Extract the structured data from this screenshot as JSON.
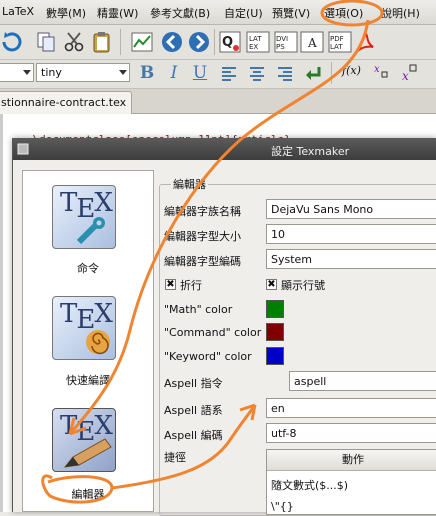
{
  "menubar": {
    "items": [
      "LaTeX",
      "數學(M)",
      "精靈(W)",
      "參考文獻(B)",
      "自定(U)",
      "預覽(V)",
      "選項(O)",
      "說明(H)"
    ]
  },
  "toolbar2": {
    "size_combo": "tiny"
  },
  "tabs": {
    "document": "stionnaire-contract.tex"
  },
  "editor": {
    "line1": "\\documentclass[onecolumn,11pt]{article}"
  },
  "dialog": {
    "title": "設定 Texmaker",
    "categories": [
      "命令",
      "快速編譯",
      "編輯器"
    ],
    "group_title": "編輯器",
    "font_family_label": "編輯器字族名稱",
    "font_family_value": "DejaVu Sans Mono",
    "font_size_label": "編輯器字型大小",
    "font_size_value": "10",
    "encoding_label": "編輯器字型編碼",
    "encoding_value": "System",
    "wrap_label": "折行",
    "line_numbers_label": "顯示行號",
    "math_color_label": "\"Math\" color",
    "command_color_label": "\"Command\" color",
    "keyword_color_label": "\"Keyword\" color",
    "aspell_cmd_label": "Aspell 指令",
    "aspell_cmd_value": "aspell",
    "aspell_lang_label": "Aspell 語系",
    "aspell_lang_value": "en",
    "aspell_enc_label": "Aspell 編碼",
    "aspell_enc_value": "utf-8",
    "shortcuts_label": "捷徑",
    "shortcuts_header": "動作",
    "shortcut_rows": [
      "隨文數式($...$)",
      "\\\"{}"
    ]
  },
  "colors": {
    "math": "#008000",
    "command": "#800000",
    "keyword": "#0000c8",
    "annotation": "#f08430"
  }
}
